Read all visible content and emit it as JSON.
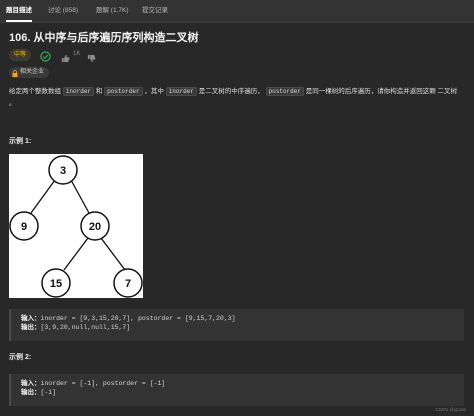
{
  "tabs": [
    {
      "label": "题目描述",
      "active": true
    },
    {
      "label": "讨论 (858)",
      "active": false
    },
    {
      "label": "题解 (1.7K)",
      "active": false
    },
    {
      "label": "提交记录",
      "active": false
    }
  ],
  "problem": {
    "title": "106. 从中序与后序遍历序列构造二叉树",
    "difficulty": "中等",
    "likes": "1K",
    "company_tag": "相关企业",
    "desc_1": "给定两个整数数组 ",
    "code_inorder": "inorder",
    "desc_2": " 和 ",
    "code_postorder": "postorder",
    "desc_3": " ，其中 ",
    "desc_4": " 是二叉树的中序遍历， ",
    "desc_5": " 是同一棵树的后序遍历，请你构造并返回这颗 二叉树 。"
  },
  "example1": {
    "heading": "示例 1:",
    "tree_nodes": [
      "3",
      "9",
      "20",
      "15",
      "7"
    ],
    "input_label": "输入：",
    "input_value": "inorder = [9,3,15,20,7], postorder = [9,15,7,20,3]",
    "output_label": "输出：",
    "output_value": "[3,9,20,null,null,15,7]"
  },
  "example2": {
    "heading": "示例 2:",
    "input_label": "输入：",
    "input_value": "inorder = [-1], postorder = [-1]",
    "output_label": "输出：",
    "output_value": "[-1]"
  },
  "watermark": "CSDN @ypJob",
  "colors": {
    "background": "#282828",
    "difficulty_medium": "#f7b500",
    "check_green": "#2cbb5d",
    "lock_orange": "#ffa116"
  },
  "icons": [
    "check-circle-icon",
    "thumbs-up-icon",
    "lock-icon"
  ]
}
